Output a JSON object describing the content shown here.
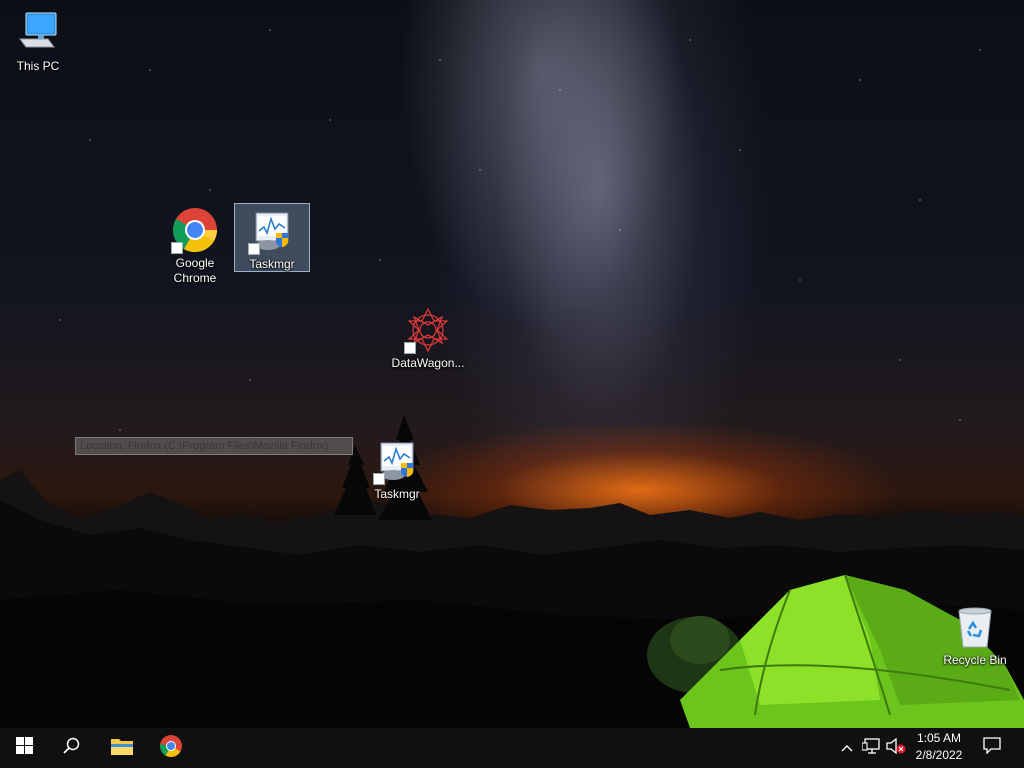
{
  "desktop_icons": {
    "this_pc": "This PC",
    "google_chrome": "Google Chrome",
    "taskmgr_1": "Taskmgr",
    "datawagon": "DataWagon...",
    "taskmgr_2": "Taskmgr",
    "recycle_bin": "Recycle Bin"
  },
  "tooltip": {
    "text": "Location: Firefox (C:\\Program Files\\Mozilla Firefox)"
  },
  "taskbar": {
    "start_icon": "windows-logo-icon",
    "search_icon": "search-icon",
    "pinned_apps": [
      "file-explorer-icon",
      "chrome-icon"
    ]
  },
  "tray": {
    "icons": [
      "chevron-up-icon",
      "network-icon",
      "volume-muted-icon"
    ],
    "time": "1:05 AM",
    "date": "2/8/2022",
    "notification_icon": "action-center-icon"
  },
  "colors": {
    "taskbar_bg": "#101010",
    "selection_bg": "#96b4d2",
    "tent_green": "#7fd81e",
    "horizon_glow": "#ff7814"
  }
}
